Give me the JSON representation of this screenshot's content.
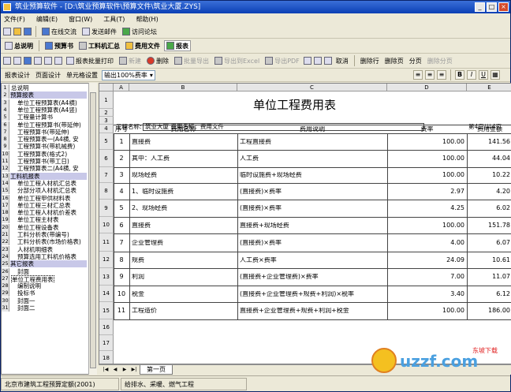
{
  "window": {
    "title": "筑业预算软件 - [D:\\筑业预算软件\\预算文件\\筑业大厦.ZYS]",
    "min": "_",
    "max": "□",
    "close": "×"
  },
  "menu": [
    "文件(F)",
    "编辑(E)",
    "窗口(W)",
    "工具(T)",
    "帮助(H)"
  ],
  "toolbar1": {
    "online": "在线交流",
    "send_mail": "发送邮件",
    "forum": "访问论坛"
  },
  "tabs": {
    "desc": "总说明",
    "budget": "预算书",
    "materials": "工料机汇总",
    "fees": "费用文件",
    "reports": "报表"
  },
  "toolbar3": {
    "batch_print": "报表批量打印",
    "new": "新建",
    "delete": "删除",
    "batch_export": "批量导出",
    "export_excel": "导出到Excel",
    "export_pdf": "导出PDF",
    "cancel": "取消",
    "delete_row": "删除行",
    "delete_page": "删除页",
    "paging": "分页",
    "delete_paging": "删除分页"
  },
  "toolbar4": {
    "report_design": "报表设计",
    "page_design": "页面设计",
    "cell_format": "单元格设置",
    "output": "输出100%费率"
  },
  "tree": [
    {
      "n": "1",
      "t": "总说明",
      "k": "plain"
    },
    {
      "n": "2",
      "t": "预算报表",
      "k": "group"
    },
    {
      "n": "3",
      "t": "单位工程预算表(A4横)",
      "k": "sub"
    },
    {
      "n": "4",
      "t": "单位工程预算表(A4竖)",
      "k": "sub"
    },
    {
      "n": "5",
      "t": "工程量计算书",
      "k": "sub"
    },
    {
      "n": "6",
      "t": "单位工程预算书(带延伸)",
      "k": "sub"
    },
    {
      "n": "7",
      "t": "工程预算书(带延伸)",
      "k": "sub"
    },
    {
      "n": "8",
      "t": "工程预算表一(A4横, 安",
      "k": "sub"
    },
    {
      "n": "9",
      "t": "工程预算书(带机械费)",
      "k": "sub"
    },
    {
      "n": "10",
      "t": "工程预算表(格式2)",
      "k": "sub"
    },
    {
      "n": "11",
      "t": "工程预算书(带工日)",
      "k": "sub"
    },
    {
      "n": "12",
      "t": "工程预算表二(A4横, 安",
      "k": "sub"
    },
    {
      "n": "13",
      "t": "工料机报表",
      "k": "group"
    },
    {
      "n": "14",
      "t": "单位工程人材机汇总表",
      "k": "sub"
    },
    {
      "n": "15",
      "t": "分部分项人材机汇总表",
      "k": "sub"
    },
    {
      "n": "16",
      "t": "单位工程甲供材料表",
      "k": "sub"
    },
    {
      "n": "17",
      "t": "单位工程三材汇总表",
      "k": "sub"
    },
    {
      "n": "18",
      "t": "单位工程人材机价差表",
      "k": "sub"
    },
    {
      "n": "19",
      "t": "单位工程主材表",
      "k": "sub"
    },
    {
      "n": "20",
      "t": "单位工程设备表",
      "k": "sub"
    },
    {
      "n": "21",
      "t": "工料分析表(带编号)",
      "k": "sub"
    },
    {
      "n": "22",
      "t": "工料分析表(市场价格表)",
      "k": "sub"
    },
    {
      "n": "23",
      "t": "人材机明细表",
      "k": "sub"
    },
    {
      "n": "24",
      "t": "预算选用工料机价格表",
      "k": "sub"
    },
    {
      "n": "25",
      "t": "其它报表",
      "k": "group"
    },
    {
      "n": "26",
      "t": "封面",
      "k": "sub"
    },
    {
      "n": "27",
      "t": "单位工程费用表",
      "k": "sel"
    },
    {
      "n": "28",
      "t": "编制说明",
      "k": "sub"
    },
    {
      "n": "29",
      "t": "投标书",
      "k": "sub"
    },
    {
      "n": "30",
      "t": "封面一",
      "k": "sub"
    },
    {
      "n": "31",
      "t": "封面二",
      "k": "sub"
    }
  ],
  "sheet": {
    "cols": [
      "A",
      "B",
      "C",
      "D",
      "E"
    ],
    "title": "单位工程费用表",
    "project_label": "工程名称:",
    "project_value": "筑业大厦 费用名称：费用文件",
    "page_info": "第4页/共4页",
    "headers": [
      "序号",
      "费用名称",
      "费用说明",
      "费率",
      "费用金额"
    ],
    "rows": [
      [
        "1",
        "直接费",
        "工程直接费",
        "100.00",
        "141.56"
      ],
      [
        "2",
        "其中：人工费",
        "人工费",
        "100.00",
        "44.04"
      ],
      [
        "3",
        "现场经费",
        "临时设施费+现场经费",
        "100.00",
        "10.22"
      ],
      [
        "4",
        "1、临时设施费",
        "(直接费)×费率",
        "2.97",
        "4.20"
      ],
      [
        "5",
        "2、现场经费",
        "(直接费)×费率",
        "4.25",
        "6.02"
      ],
      [
        "6",
        "直接费",
        "直接费+现场经费",
        "100.00",
        "151.78"
      ],
      [
        "7",
        "企业管理费",
        "(直接费)×费率",
        "4.00",
        "6.07"
      ],
      [
        "8",
        "规费",
        "人工费×费率",
        "24.09",
        "10.61"
      ],
      [
        "9",
        "利润",
        "(直接费+企业管理费)×费率",
        "7.00",
        "11.07"
      ],
      [
        "10",
        "税金",
        "(直接费+企业管理费+规费+利润)×税率",
        "3.40",
        "6.12"
      ],
      [
        "11",
        "工程造价",
        "直接费+企业管理费+规费+利润+税金",
        "100.00",
        "186.00"
      ]
    ]
  },
  "sheet_tab": "第一页",
  "status": {
    "left": "北京市建筑工程预算定额(2001)",
    "right": "给排水、采暖、燃气工程"
  },
  "watermark": {
    "brand": "uzzf.com",
    "tagline": "东坡下载"
  }
}
